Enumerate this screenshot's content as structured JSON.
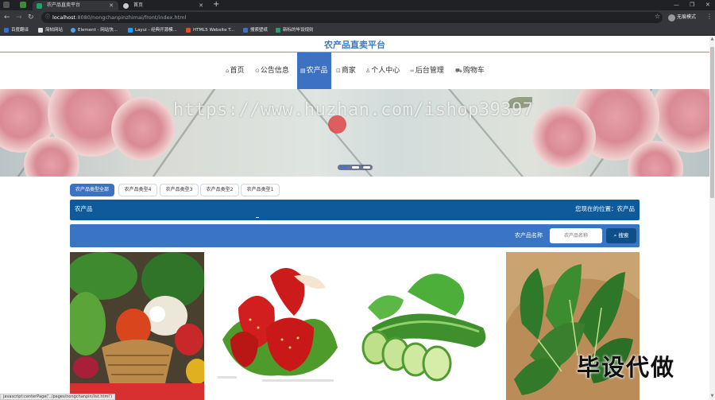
{
  "browser": {
    "tabs": [
      {
        "title": "农产品直卖平台"
      },
      {
        "title": "首页"
      }
    ],
    "url_host": "localhost",
    "url_path": ":8080/nongchanpinzhimai/front/index.html",
    "incognito_label": "无痕模式",
    "bookmarks": [
      {
        "label": "百度翻译",
        "color": "#2f6fd6"
      },
      {
        "label": "简帖网站",
        "color": "#222222"
      },
      {
        "label": "Element - 网站快...",
        "color": "#4aa3ff"
      },
      {
        "label": "Layui - 经典开源模...",
        "color": "#1e9fff"
      },
      {
        "label": "HTML5 Website T...",
        "color": "#e34c26"
      },
      {
        "label": "搜索壁纸",
        "color": "#3d72c2"
      },
      {
        "label": "新标的毕设规则",
        "color": "#22a06b"
      }
    ]
  },
  "site": {
    "title": "农产品直卖平台",
    "nav": [
      {
        "label": "首页",
        "icon": "home-icon",
        "glyph": "⌂"
      },
      {
        "label": "公告信息",
        "icon": "notice-icon",
        "glyph": "⊙"
      },
      {
        "label": "农产品",
        "icon": "product-icon",
        "glyph": "▤",
        "active": true
      },
      {
        "label": "商家",
        "icon": "shop-icon",
        "glyph": "⊡"
      },
      {
        "label": "个人中心",
        "icon": "user-icon",
        "glyph": "♙"
      },
      {
        "label": "后台管理",
        "icon": "link-icon",
        "glyph": "∞"
      },
      {
        "label": "购物车",
        "icon": "cart-icon",
        "glyph": "⛟"
      }
    ],
    "banner_watermark": "https://www.huzhan.com/ishop39397",
    "categories": [
      "农产品类型全部",
      "农产品类型4",
      "农产品类型3",
      "农产品类型2",
      "农产品类型1"
    ],
    "location": {
      "section": "农产品",
      "prefix": "您现在的位置：",
      "current": "农产品"
    },
    "search": {
      "label": "农产品名称",
      "placeholder": "农产品名称",
      "button": "搜索"
    },
    "products": [
      {
        "image": "vegetable-basket-image"
      },
      {
        "image": "strawberry-image"
      },
      {
        "image": "cucumber-image"
      },
      {
        "image": "spinach-image"
      }
    ],
    "overlay_text": "毕设代做",
    "status_url": "javascript:centerPage('../pages/nongchanpin/list.html')"
  },
  "colors": {
    "accent": "#3d72c2",
    "location_bar": "#0e5a9a",
    "title": "#3e7ab8"
  }
}
